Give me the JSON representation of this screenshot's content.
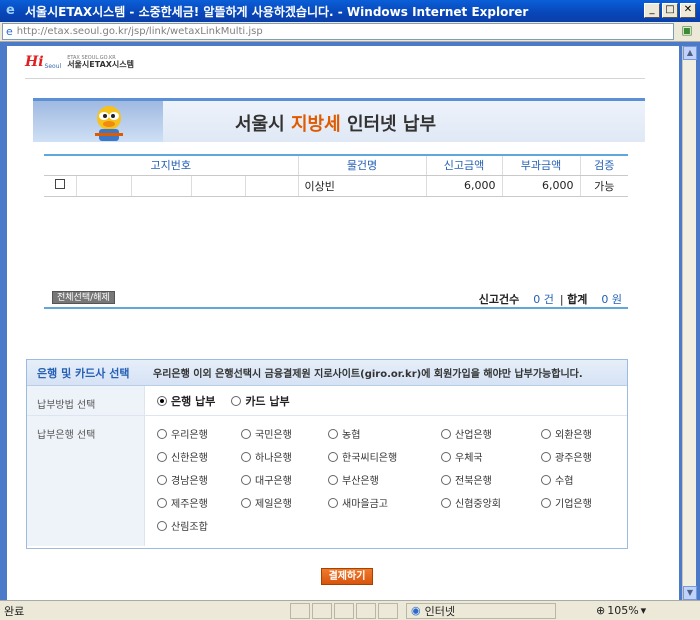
{
  "window": {
    "title": "서울시ETAX시스템 - 소중한세금! 알뜰하게 사용하겠습니다. - Windows Internet Explorer",
    "url": "http://etax.seoul.go.kr/jsp/link/wetaxLinkMulti.jsp"
  },
  "logo": {
    "hi": "Hi",
    "seoul": "Seoul",
    "top": "ETAX SEOUL.GO.KR",
    "bottom": "서울시ETAX시스템"
  },
  "banner": {
    "title_prefix": "서울시",
    "title_highlight": "지방세",
    "title_suffix": "인터넷 납부"
  },
  "table": {
    "headers": [
      "고지번호",
      "물건명",
      "신고금액",
      "부과금액",
      "검증"
    ],
    "rows": [
      {
        "name": "이상빈",
        "reported": "6,000",
        "assessed": "6,000",
        "status": "가능"
      }
    ]
  },
  "summary": {
    "select_all": "전체선택/해제",
    "count_label": "신고건수",
    "count_value": "0 건",
    "separator": "|",
    "total_label": "합계",
    "total_value": "0 원"
  },
  "bank_section": {
    "title": "은행 및 카드사 선택",
    "note": "우리은행 이외 은행선택시 금융결제원 지로사이트(giro.or.kr)에 회원가입을 해야만 납부가능합니다.",
    "method_label": "납부방법 선택",
    "methods": [
      "은행 납부",
      "카드 납부"
    ],
    "bank_label": "납부은행 선택",
    "banks": [
      "우리은행",
      "국민은행",
      "농협",
      "산업은행",
      "외환은행",
      "신한은행",
      "하나은행",
      "한국씨티은행",
      "우체국",
      "광주은행",
      "경남은행",
      "대구은행",
      "부산은행",
      "전북은행",
      "수협",
      "제주은행",
      "제일은행",
      "새마을금고",
      "신협중앙회",
      "기업은행",
      "산림조합"
    ]
  },
  "pay_button": "결제하기",
  "status": {
    "text": "완료",
    "zone": "인터넷",
    "zoom": "105%"
  }
}
